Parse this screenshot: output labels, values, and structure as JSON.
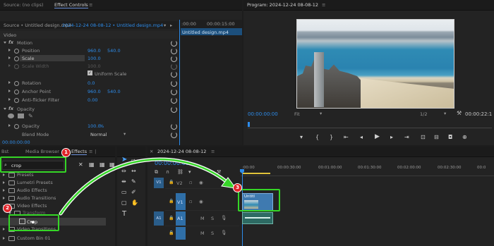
{
  "source_panel": {
    "tab_source": "Source: (no clips)",
    "tab_effect_controls": "Effect Controls",
    "menu_icon": "≡",
    "source_label": "Source • Untitled design.mp4",
    "seq_label": "2024-12-24 08-08-12 • Untitled design.mp4",
    "ruler_time": ":00:00",
    "ruler_end": "00:00:15:00",
    "clip_name": "Untitled design.mp4",
    "video_header": "Video",
    "motion": "Motion",
    "position_label": "Position",
    "position_x": "960.0",
    "position_y": "540.0",
    "scale_label": "Scale",
    "scale_value": "100.0",
    "scale_width_label": "Scale Width",
    "scale_width_value": "100.0",
    "uniform_scale": "Uniform Scale",
    "rotation_label": "Rotation",
    "rotation_value": "0.0",
    "anchor_label": "Anchor Point",
    "anchor_x": "960.0",
    "anchor_y": "540.0",
    "antiflicker_label": "Anti-flicker Filter",
    "antiflicker_value": "0.00",
    "opacity_header": "Opacity",
    "opacity_label": "Opacity",
    "opacity_value": "100.0",
    "opacity_unit": "%",
    "blend_label": "Blend Mode",
    "blend_value": "Normal",
    "timecode": "00:00:00:00"
  },
  "program_panel": {
    "title": "Program: 2024-12-24 08-08-12",
    "menu_icon": "≡",
    "timecode": "00:00:00:00",
    "fit": "Fit",
    "resolution": "1/2",
    "end_timecode": "00:00:22:1"
  },
  "project_panel": {
    "tab_list": "Bst",
    "tab_media_browser": "Media Browser",
    "tab_effects": "Effects",
    "tab_more": "≡ ∣",
    "search_value": "crop",
    "items": [
      {
        "label": "Presets"
      },
      {
        "label": "Lumetri Presets"
      },
      {
        "label": "Audio Effects"
      },
      {
        "label": "Audio Transitions"
      },
      {
        "label": "Video Effects"
      },
      {
        "label": "Transform"
      },
      {
        "label": "Crop"
      },
      {
        "label": "Video Transitions"
      },
      {
        "label": "Custom Bin 01"
      }
    ]
  },
  "timeline_panel": {
    "title": "2024-12-24 08-08-12",
    "menu_icon": "≡",
    "timecode": "00:00:00:00",
    "ruler": [
      ":00:00",
      "00:00:30:00",
      "00:01:00:00",
      "00:01:30:00",
      "00:02:00:00",
      "00:02:30:00",
      "00:0"
    ],
    "tracks": [
      {
        "name": "V2",
        "src": "V1"
      },
      {
        "name": "V1",
        "src": ""
      },
      {
        "name": "A1",
        "src": "A1"
      },
      {
        "name": "A2",
        "src": ""
      }
    ],
    "clip_label": "Untitl"
  },
  "steps": [
    "1",
    "2",
    "3"
  ],
  "colors": {
    "accent_blue": "#2d8ceb",
    "highlight_green": "#35d626",
    "badge_red": "#e0242a"
  }
}
